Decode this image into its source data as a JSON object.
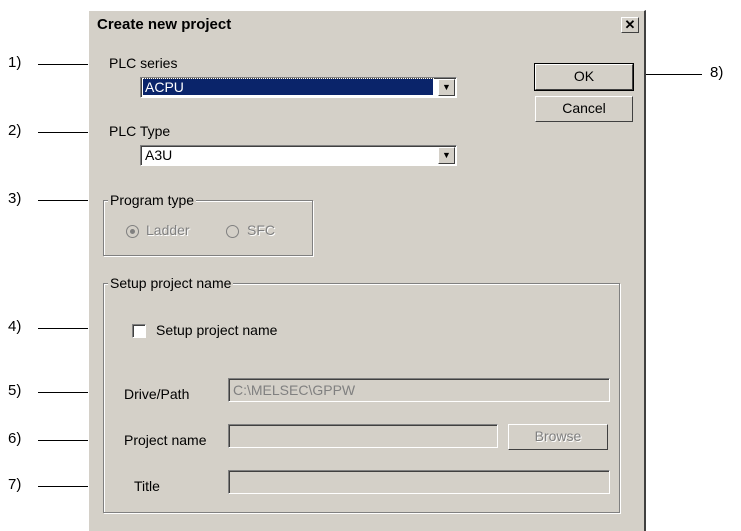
{
  "dialog": {
    "title": "Create new project",
    "close_glyph": "✕"
  },
  "plc_series": {
    "label": "PLC series",
    "value": "ACPU"
  },
  "plc_type": {
    "label": "PLC Type",
    "value": "A3U"
  },
  "program_type": {
    "label": "Program type",
    "options": [
      "Ladder",
      "SFC"
    ],
    "selected": "Ladder"
  },
  "setup": {
    "group_label": "Setup project name",
    "checkbox_label": "Setup project name",
    "checked": false,
    "drive_path_label": "Drive/Path",
    "drive_path_value": "C:\\MELSEC\\GPPW",
    "project_name_label": "Project name",
    "project_name_value": "",
    "title_label": "Title",
    "title_value": "",
    "browse_label": "Browse"
  },
  "buttons": {
    "ok": "OK",
    "cancel": "Cancel"
  },
  "callouts": [
    "1)",
    "2)",
    "3)",
    "4)",
    "5)",
    "6)",
    "7)",
    "8)"
  ]
}
